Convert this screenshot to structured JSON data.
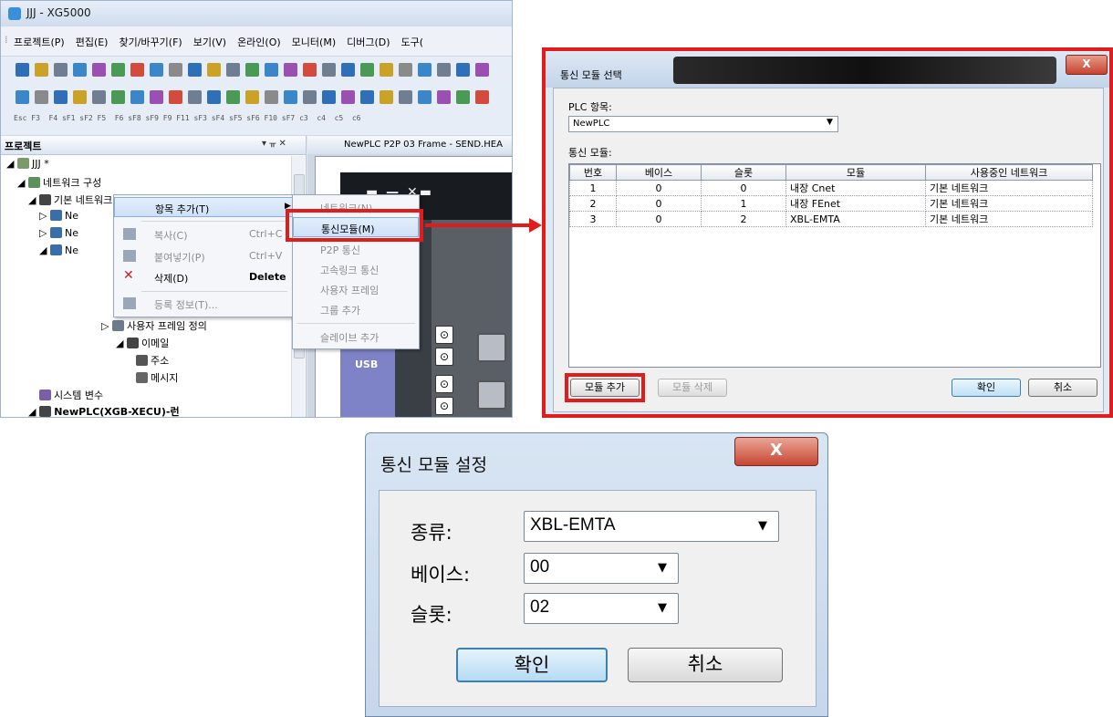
{
  "main_window": {
    "title": "JJJ - XG5000",
    "menu": [
      "프로젝트(P)",
      "편집(E)",
      "찾기/바꾸기(F)",
      "보기(V)",
      "온라인(O)",
      "모니터(M)",
      "디버그(D)",
      "도구("
    ],
    "function_keys": "Esc F3  F4 sF1 sF2 F5  F6 sF8 sF9 F9 F11 sF3 sF4 sF5 sF6 F10 sF7 c3  c4  c5  c6",
    "project_pane_title": "프로젝트",
    "project_pane_pin": "▾ ᚂ ✕",
    "editor_tab": "NewPLC P2P 03 Frame - SEND.HEA",
    "plc_usb_label": "USB",
    "tree": {
      "root": "JJJ *",
      "network_config": "네트워크 구성",
      "basic_network": "기본 네트워크",
      "ne1": "Ne",
      "ne2": "Ne",
      "ne3": "Ne",
      "user_frame": "사용자 프레임 정의",
      "email": "이메일",
      "address": "주소",
      "message": "메시지",
      "system_vars": "시스템 변수",
      "newplc": "NewPLC(XGB-XECU)-런"
    }
  },
  "context_menu": {
    "add_item": "항목 추가(T)",
    "copy": "복사(C)",
    "copy_shortcut": "Ctrl+C",
    "paste": "붙여넣기(P)",
    "paste_shortcut": "Ctrl+V",
    "delete": "삭제(D)",
    "delete_shortcut": "Delete",
    "register_info": "등록 정보(T)..."
  },
  "submenu": {
    "network": "네트워크(N)",
    "comm_module": "통신모듈(M)",
    "p2p": "P2P 통신",
    "highspeed_link": "고속링크 통신",
    "user_frame": "사용자 프레임",
    "add_group": "그룹 추가",
    "add_slave": "슬레이브 추가"
  },
  "dialog_select": {
    "title": "통신 모듈 선택",
    "close_label": "X",
    "plc_label": "PLC 항목:",
    "plc_value": "NewPLC",
    "modules_label": "통신 모듈:",
    "columns": [
      "번호",
      "베이스",
      "슬롯",
      "모듈",
      "사용중인 네트워크"
    ],
    "rows": [
      [
        "1",
        "0",
        "0",
        "내장 Cnet",
        "기본 네트워크"
      ],
      [
        "2",
        "0",
        "1",
        "내장 FEnet",
        "기본 네트워크"
      ],
      [
        "3",
        "0",
        "2",
        "XBL-EMTA",
        "기본 네트워크"
      ]
    ],
    "add_button": "모듈 추가",
    "delete_button": "모듈 삭제",
    "ok_button": "확인",
    "cancel_button": "취소"
  },
  "dialog_setting": {
    "title": "통신 모듈 설정",
    "close_label": "X",
    "type_label": "종류:",
    "type_value": "XBL-EMTA",
    "base_label": "베이스:",
    "base_value": "00",
    "slot_label": "슬롯:",
    "slot_value": "02",
    "ok_button": "확인",
    "cancel_button": "취소"
  },
  "colors": {
    "highlight_red": "#e21b1b",
    "title_bar": "#c3d4ea"
  }
}
